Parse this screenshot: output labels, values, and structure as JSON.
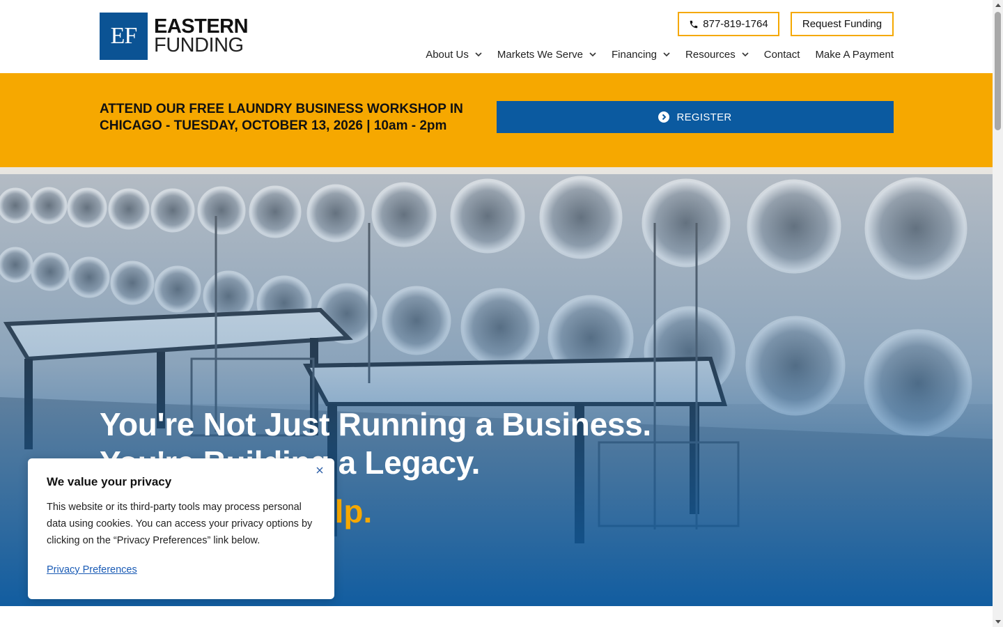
{
  "header": {
    "logo_mark": "EF",
    "logo_line1": "EASTERN",
    "logo_line2": "FUNDING",
    "phone_label": "877-819-1764",
    "request_label": "Request Funding",
    "nav": [
      {
        "label": "About Us",
        "has_dropdown": true
      },
      {
        "label": "Markets We Serve",
        "has_dropdown": true
      },
      {
        "label": "Financing",
        "has_dropdown": true
      },
      {
        "label": "Resources",
        "has_dropdown": true
      },
      {
        "label": "Contact",
        "has_dropdown": false
      },
      {
        "label": "Make A Payment",
        "has_dropdown": false
      }
    ]
  },
  "banner": {
    "line1": "ATTEND OUR FREE LAUNDRY BUSINESS WORKSHOP IN",
    "line2": "CHICAGO - TUESDAY, OCTOBER 13, 2026 | 10am - 2pm",
    "register_label": "REGISTER"
  },
  "hero": {
    "line1": "You're Not Just Running a Business.",
    "line2": "You're Building a Legacy.",
    "accent_visible": "elp."
  },
  "privacy": {
    "title": "We value your privacy",
    "body": "This website or its third-party tools may process personal data using cookies. You can access your privacy options by clicking on the “Privacy Preferences” link below.",
    "link_label": "Privacy Preferences"
  },
  "colors": {
    "brand_blue": "#0b5394",
    "accent_orange": "#f6a800",
    "register_blue": "#0b5aa0"
  }
}
